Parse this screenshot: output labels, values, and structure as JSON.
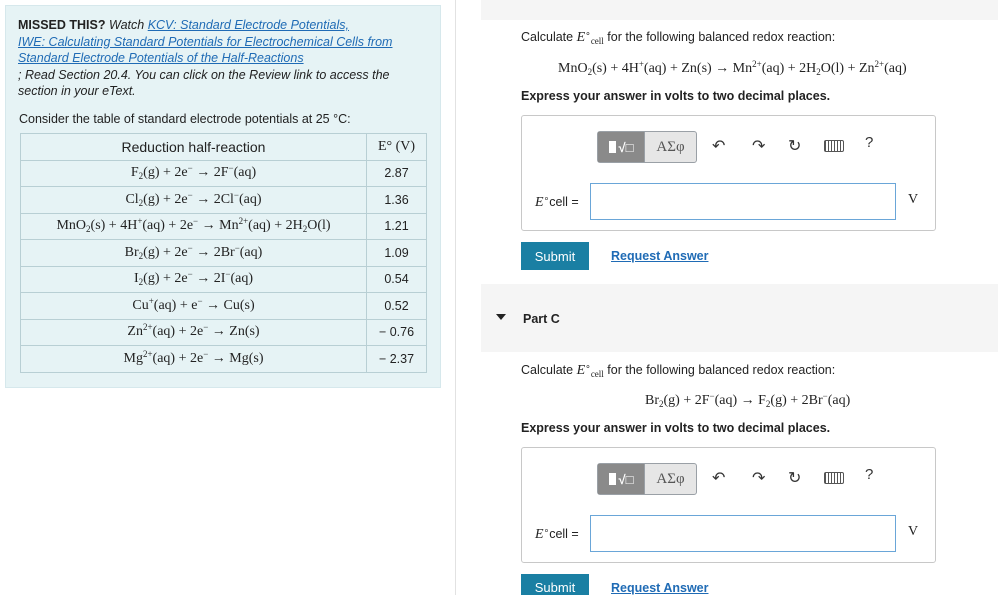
{
  "left": {
    "missed": {
      "prefix_bold": "MISSED THIS?",
      "watch": "Watch",
      "link1": "KCV: Standard Electrode Potentials,",
      "link2": "IWE: Calculating Standard Potentials for Electrochemical Cells from",
      "link3": "Standard Electrode Potentials of the Half-Reactions",
      "read1": "; Read Section 20.4. You can click on the Review link to access the",
      "read2": "section in your eText."
    },
    "consider": "Consider the table of standard electrode potentials at 25 °C:",
    "table": {
      "header_reaction": "Reduction half-reaction",
      "header_e": "E° (V)",
      "values": [
        "2.87",
        "1.36",
        "1.21",
        "1.09",
        "0.54",
        "0.52",
        "− 0.76",
        "− 2.37"
      ]
    }
  },
  "partB": {
    "calc_prefix": "Calculate",
    "calc_suffix": "for the following balanced redox reaction:",
    "instruction": "Express your answer in volts to two decimal places.",
    "ecell_label": "cell =",
    "unit": "V",
    "submit": "Submit",
    "request": "Request Answer"
  },
  "partC": {
    "title": "Part C",
    "calc_prefix": "Calculate",
    "calc_suffix": "for the following balanced redox reaction:",
    "instruction": "Express your answer in volts to two decimal places.",
    "ecell_label": "cell =",
    "unit": "V",
    "submit": "Submit",
    "request": "Request Answer"
  },
  "toolbar": {
    "templates_icon": "fraction-sqrt-icon",
    "symbols_label": "ΑΣφ",
    "undo_icon": "undo-icon",
    "redo_icon": "redo-icon",
    "reset_icon": "reset-icon",
    "keyboard_icon": "keyboard-icon",
    "help_label": "?"
  }
}
